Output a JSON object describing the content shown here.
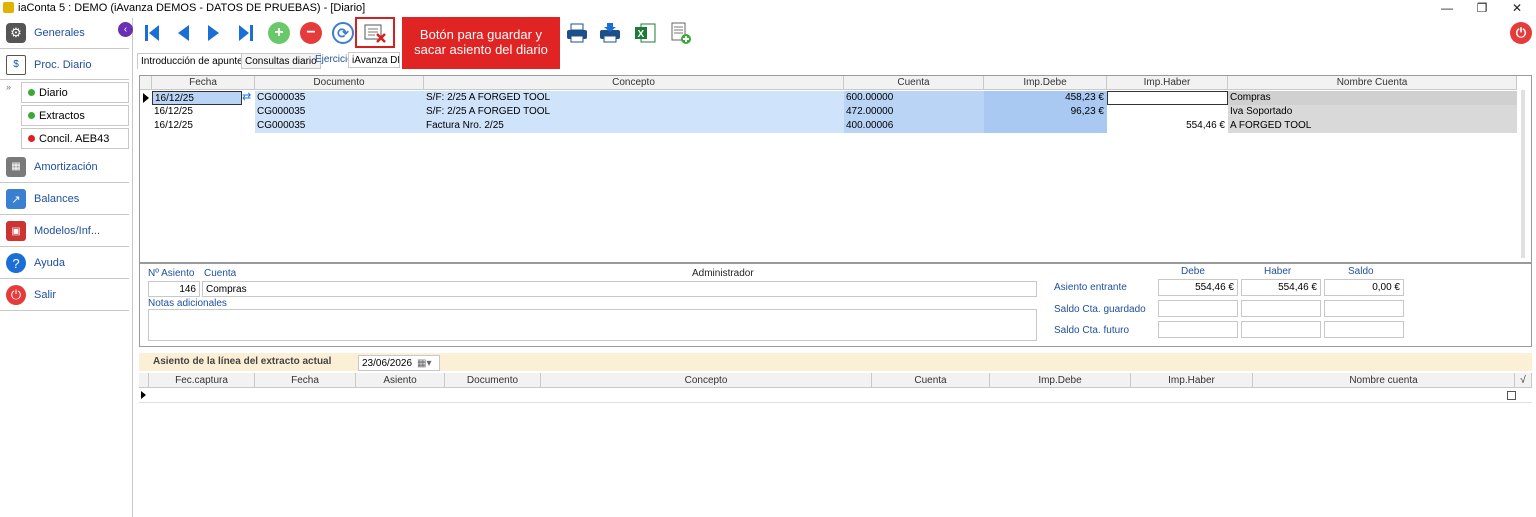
{
  "window": {
    "title": "iaConta 5 : DEMO (iAvanza DEMOS - DATOS DE PRUEBAS) - [Diario]",
    "minimize": "—",
    "maximize": "❐",
    "close": "✕"
  },
  "sidebar": {
    "items": [
      {
        "label": "Generales",
        "icon": "gear-icon"
      },
      {
        "label": "Proc. Diario",
        "icon": "journal-icon"
      },
      {
        "label": "Amortización",
        "icon": "calculator-icon"
      },
      {
        "label": "Balances",
        "icon": "chart-icon"
      },
      {
        "label": "Modelos/Inf...",
        "icon": "presentation-icon"
      },
      {
        "label": "Ayuda",
        "icon": "help-icon"
      },
      {
        "label": "Salir",
        "icon": "power-icon"
      }
    ],
    "subitems": [
      {
        "label": "Diario",
        "color": "#3aa83a"
      },
      {
        "label": "Extractos",
        "color": "#3aa83a"
      },
      {
        "label": "Concil. AEB43",
        "color": "#e02020"
      }
    ],
    "collapse_glyph": "‹"
  },
  "toolbar": {
    "tooltip_line1": "Botón para  guardar y",
    "tooltip_line2": "sacar asiento del diario",
    "add_glyph": "+",
    "remove_glyph": "−",
    "refresh_glyph": "⟳",
    "power_glyph": "⏻"
  },
  "tabs": [
    {
      "label": "Introducción de apuntes"
    },
    {
      "label": "Consultas diario"
    }
  ],
  "ejercicio": {
    "label": "Ejercicio",
    "value": "iAvanza DEMO"
  },
  "grid1": {
    "headers": [
      "Fecha",
      "Documento",
      "Concepto",
      "Cuenta",
      "Imp.Debe",
      "Imp.Haber",
      "Nombre Cuenta"
    ],
    "rows": [
      {
        "fecha": "16/12/25",
        "documento": "CG000035",
        "concepto": "S/F: 2/25 A FORGED TOOL",
        "cuenta": "600.00000",
        "debe": "458,23 €",
        "haber": "",
        "nombre": "Compras"
      },
      {
        "fecha": "16/12/25",
        "documento": "CG000035",
        "concepto": "S/F: 2/25 A FORGED TOOL",
        "cuenta": "472.00000",
        "debe": "96,23 €",
        "haber": "",
        "nombre": "Iva Soportado"
      },
      {
        "fecha": "16/12/25",
        "documento": "CG000035",
        "concepto": "Factura Nro. 2/25",
        "cuenta": "400.00006",
        "debe": "",
        "haber": "554,46 €",
        "nombre": "A FORGED TOOL"
      }
    ]
  },
  "detail": {
    "nro_asiento_label": "Nº Asiento",
    "cuenta_label": "Cuenta",
    "usuario": "Administrador",
    "nro_asiento": "146",
    "cuenta_nombre": "Compras",
    "notas_label": "Notas adicionales",
    "debe_label": "Debe",
    "haber_label": "Haber",
    "saldo_label": "Saldo",
    "asiento_entrante_label": "Asiento entrante",
    "saldo_guardado_label": "Saldo Cta. guardado",
    "saldo_futuro_label": "Saldo Cta. futuro",
    "entrante_debe": "554,46 €",
    "entrante_haber": "554,46 €",
    "entrante_saldo": "0,00 €"
  },
  "extract": {
    "title": "Asiento de la línea del extracto actual",
    "date": "23/06/2026",
    "headers": [
      "Fec.captura",
      "Fecha",
      "Asiento",
      "Documento",
      "Concepto",
      "Cuenta",
      "Imp.Debe",
      "Imp.Haber",
      "Nombre cuenta",
      "√"
    ]
  },
  "colors": {
    "accent_blue": "#1e4f9c",
    "nav_blue": "#1a6fd6",
    "selected_row": "#cfe3fb",
    "highlight_red": "#e02323"
  }
}
